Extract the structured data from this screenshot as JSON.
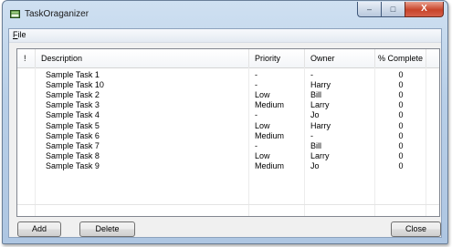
{
  "window": {
    "title": "TaskOraganizer",
    "controls": {
      "minimize": "–",
      "maximize": "□",
      "close": "X"
    }
  },
  "menu": {
    "file_label": "File",
    "file_mnemonic": "F",
    "file_rest": "ile"
  },
  "table": {
    "headers": [
      "!",
      "Description",
      "Priority",
      "Owner",
      "% Complete"
    ],
    "rows": [
      {
        "description": "Sample Task 1",
        "priority": "-",
        "owner": "-",
        "complete": "0"
      },
      {
        "description": "Sample Task 10",
        "priority": "-",
        "owner": "Harry",
        "complete": "0"
      },
      {
        "description": "Sample Task 2",
        "priority": "Low",
        "owner": "Bill",
        "complete": "0"
      },
      {
        "description": "Sample Task 3",
        "priority": "Medium",
        "owner": "Larry",
        "complete": "0"
      },
      {
        "description": "Sample Task 4",
        "priority": "-",
        "owner": "Jo",
        "complete": "0"
      },
      {
        "description": "Sample Task 5",
        "priority": "Low",
        "owner": "Harry",
        "complete": "0"
      },
      {
        "description": "Sample Task 6",
        "priority": "Medium",
        "owner": "-",
        "complete": "0"
      },
      {
        "description": "Sample Task 7",
        "priority": "-",
        "owner": "Bill",
        "complete": "0"
      },
      {
        "description": "Sample Task 8",
        "priority": "Low",
        "owner": "Larry",
        "complete": "0"
      },
      {
        "description": "Sample Task 9",
        "priority": "Medium",
        "owner": "Jo",
        "complete": "0"
      }
    ]
  },
  "buttons": {
    "add": "Add",
    "delete": "Delete",
    "close": "Close"
  },
  "colors": {
    "title_bar": "#b8cfe8",
    "close_button": "#c8442a",
    "client_bg": "#f0f0f0"
  },
  "icons": {
    "app": "app-window-icon"
  }
}
